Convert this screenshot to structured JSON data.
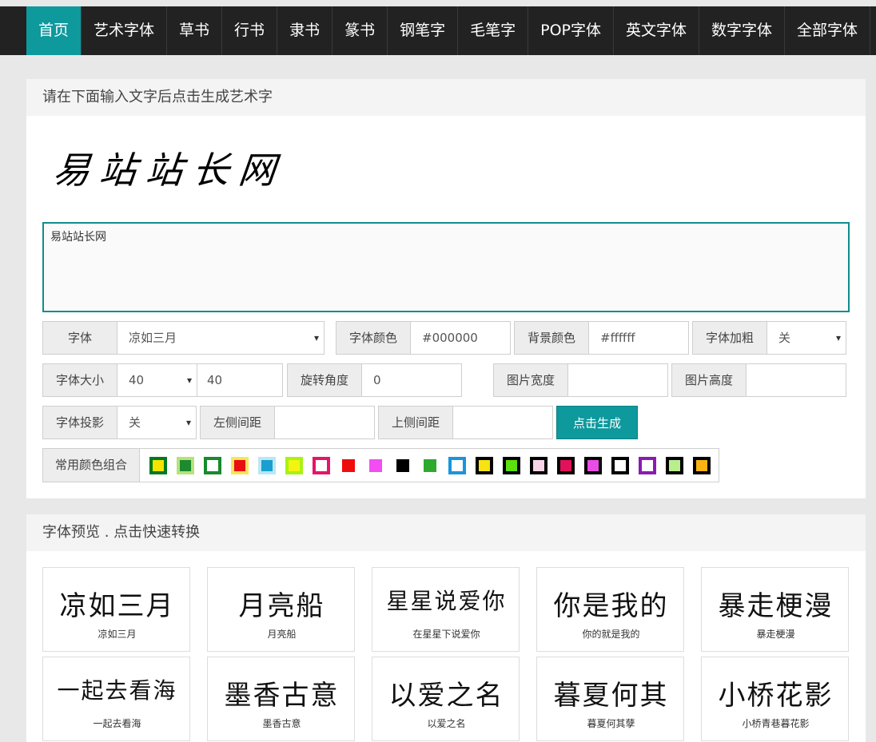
{
  "nav": {
    "items": [
      "首页",
      "艺术字体",
      "草书",
      "行书",
      "隶书",
      "篆书",
      "钢笔字",
      "毛笔字",
      "POP字体",
      "英文字体",
      "数字字体",
      "全部字体"
    ]
  },
  "generator": {
    "heading": "请在下面输入文字后点击生成艺术字",
    "preview_text": "易站站长网",
    "input_value": "易站站长网",
    "font_label": "字体",
    "font_value": "凉如三月",
    "font_color_label": "字体颜色",
    "font_color_value": "#000000",
    "bg_color_label": "背景颜色",
    "bg_color_value": "#ffffff",
    "bold_label": "字体加粗",
    "bold_value": "关",
    "size_label": "字体大小",
    "size_select": "40",
    "size_value": "40",
    "rotate_label": "旋转角度",
    "rotate_value": "0",
    "width_label": "图片宽度",
    "width_value": "",
    "height_label": "图片高度",
    "height_value": "",
    "shadow_label": "字体投影",
    "shadow_value": "关",
    "left_label": "左侧间距",
    "left_value": "",
    "top_label": "上侧间距",
    "top_value": "",
    "generate_label": "点击生成",
    "combo_label": "常用颜色组合"
  },
  "swatches": [
    {
      "fill": "#f4e400",
      "border": "#007a1f"
    },
    {
      "fill": "#1c8a2e",
      "border": "#b7e27a"
    },
    {
      "fill": "#ffffff",
      "border": "#168a2e"
    },
    {
      "fill": "#e81010",
      "border": "#f9e45a"
    },
    {
      "fill": "#1a9fd0",
      "border": "#b9e8f4"
    },
    {
      "fill": "#f4f412",
      "border": "#a8f312"
    },
    {
      "fill": "#ffffff",
      "border": "#e4156b"
    },
    {
      "fill": "#ef0c0c",
      "border": "#ffffff"
    },
    {
      "fill": "#f24df0",
      "border": "#ffffff"
    },
    {
      "fill": "#000000",
      "border": "#ffffff"
    },
    {
      "fill": "#2daa2d",
      "border": "#ffffff"
    },
    {
      "fill": "#ffffff",
      "border": "#1b94dc"
    },
    {
      "fill": "#f7e312",
      "border": "#000000"
    },
    {
      "fill": "#5ce10d",
      "border": "#000000"
    },
    {
      "fill": "#f8d3e6",
      "border": "#000000"
    },
    {
      "fill": "#e2115c",
      "border": "#000000"
    },
    {
      "fill": "#ea4de6",
      "border": "#000000"
    },
    {
      "fill": "#ffffff",
      "border": "#000000"
    },
    {
      "fill": "#ffffff",
      "border": "#8c1ab2"
    },
    {
      "fill": "#b8ef8c",
      "border": "#000000"
    },
    {
      "fill": "#f8b312",
      "border": "#000000"
    }
  ],
  "fonts": {
    "heading": "字体预览 . 点击快速转换",
    "cards": [
      {
        "art": "凉如三月",
        "name": "凉如三月"
      },
      {
        "art": "月亮船",
        "name": "月亮船"
      },
      {
        "art": "星星说爱你",
        "name": "在星星下说爱你"
      },
      {
        "art": "你是我的",
        "name": "你的就是我的"
      },
      {
        "art": "暴走梗漫",
        "name": "暴走梗漫"
      },
      {
        "art": "一起去看海",
        "name": "一起去看海"
      },
      {
        "art": "墨香古意",
        "name": "墨香古意"
      },
      {
        "art": "以爱之名",
        "name": "以爱之名"
      },
      {
        "art": "暮夏何其",
        "name": "暮夏何其孽"
      },
      {
        "art": "小桥花影",
        "name": "小桥青巷暮花影"
      }
    ]
  }
}
